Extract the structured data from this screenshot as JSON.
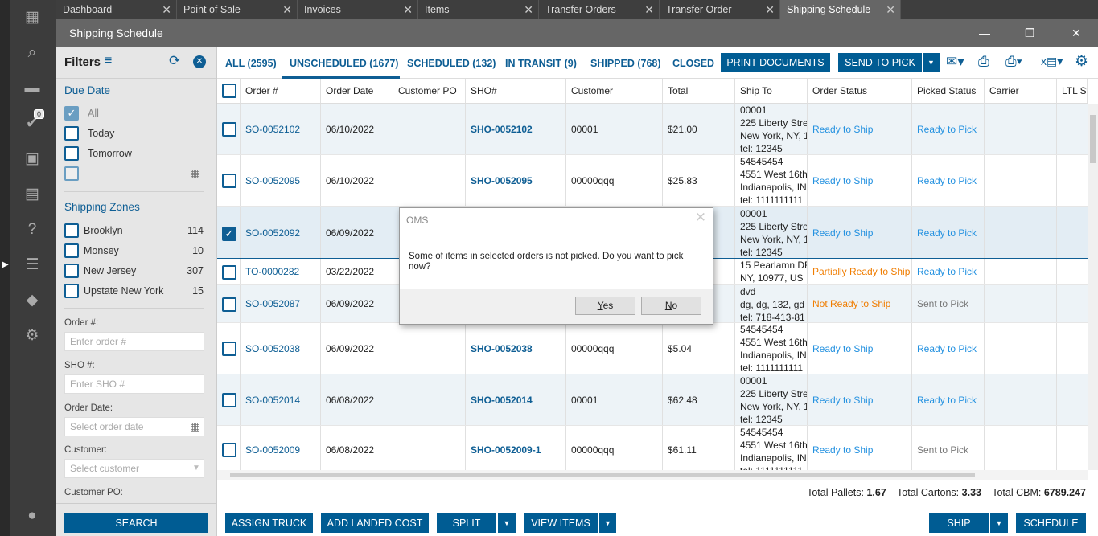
{
  "rail": {
    "icons": [
      "dashboard-icon",
      "search-icon",
      "folder-icon",
      "check-circle-icon",
      "contact-icon",
      "store-icon",
      "clipboard-question-icon",
      "clipboard-list-icon",
      "tag-icon",
      "gear-icon",
      "user-icon"
    ],
    "badge": "0"
  },
  "tabs": [
    {
      "label": "Dashboard"
    },
    {
      "label": "Point of Sale"
    },
    {
      "label": "Invoices"
    },
    {
      "label": "Items"
    },
    {
      "label": "Transfer Orders"
    },
    {
      "label": "Transfer Order"
    },
    {
      "label": "Shipping Schedule",
      "active": true
    }
  ],
  "window": {
    "title": "Shipping Schedule"
  },
  "filters": {
    "title": "Filters",
    "due_date": {
      "title": "Due Date",
      "options": [
        {
          "label": "All",
          "checked": true
        },
        {
          "label": "Today",
          "checked": false
        },
        {
          "label": "Tomorrow",
          "checked": false
        }
      ]
    },
    "zones": {
      "title": "Shipping Zones",
      "items": [
        {
          "label": "Brooklyn",
          "count": "114"
        },
        {
          "label": "Monsey",
          "count": "10"
        },
        {
          "label": "New Jersey",
          "count": "307"
        },
        {
          "label": "Upstate New York",
          "count": "15"
        }
      ]
    },
    "order_label": "Order #:",
    "order_ph": "Enter order #",
    "sho_label": "SHO #:",
    "sho_ph": "Enter SHO #",
    "date_label": "Order Date:",
    "date_ph": "Select order date",
    "customer_label": "Customer:",
    "customer_ph": "Select customer",
    "po_label": "Customer PO:",
    "search": "SEARCH"
  },
  "page_tabs": [
    {
      "label": "ALL (2595)"
    },
    {
      "label": "UNSCHEDULED (1677)",
      "active": true
    },
    {
      "label": "SCHEDULED (132)"
    },
    {
      "label": "IN TRANSIT (9)"
    },
    {
      "label": "SHIPPED (768)"
    },
    {
      "label": "CLOSED"
    }
  ],
  "toolbar": {
    "print": "PRINT DOCUMENTS",
    "send": "SEND TO PICK"
  },
  "columns": [
    "Order #",
    "Order Date",
    "Customer PO",
    "SHO#",
    "Customer",
    "Total",
    "Ship To",
    "Order Status",
    "Picked Status",
    "Carrier",
    "LTL Status"
  ],
  "rows": [
    {
      "order": "SO-0052102",
      "date": "06/10/2022",
      "po": "",
      "sho": "SHO-0052102",
      "customer": "00001",
      "total": "$21.00",
      "ship_to": [
        "00001",
        "225 Liberty Stre",
        "New York, NY, 1",
        "tel: 12345"
      ],
      "status": "Ready to Ship",
      "status_color": "blue",
      "picked": "Ready to Pick",
      "picked_color": "blue",
      "checked": false
    },
    {
      "order": "SO-0052095",
      "date": "06/10/2022",
      "po": "",
      "sho": "SHO-0052095",
      "customer": "00000qqq",
      "total": "$25.83",
      "ship_to": [
        "54545454",
        "4551 West 16th",
        "Indianapolis, IN",
        "tel: 1111111111"
      ],
      "status": "Ready to Ship",
      "status_color": "blue",
      "picked": "Ready to Pick",
      "picked_color": "blue",
      "checked": false
    },
    {
      "order": "SO-0052092",
      "date": "06/09/2022",
      "po": "",
      "sho": "",
      "customer": "",
      "total": "",
      "ship_to": [
        "00001",
        "225 Liberty Stre",
        "New York, NY, 1",
        "tel: 12345"
      ],
      "status": "Ready to Ship",
      "status_color": "blue",
      "picked": "Ready to Pick",
      "picked_color": "blue",
      "checked": true
    },
    {
      "order": "TO-0000282",
      "date": "03/22/2022",
      "po": "",
      "sho": "",
      "customer": "",
      "total": "",
      "ship_to": [
        "15 Pearlamn DF",
        "NY, 10977, US"
      ],
      "status": "Partially Ready to Ship",
      "status_color": "orange",
      "picked": "Ready to Pick",
      "picked_color": "blue",
      "checked": false
    },
    {
      "order": "SO-0052087",
      "date": "06/09/2022",
      "po": "",
      "sho": "",
      "customer": "",
      "total": "",
      "ship_to": [
        "dvd",
        "dg, dg, 132, gd",
        "tel: 718-413-81"
      ],
      "status": "Not Ready to Ship",
      "status_color": "orange",
      "picked": "Sent to Pick",
      "picked_color": "gray",
      "checked": false
    },
    {
      "order": "SO-0052038",
      "date": "06/09/2022",
      "po": "",
      "sho": "SHO-0052038",
      "customer": "00000qqq",
      "total": "$5.04",
      "ship_to": [
        "54545454",
        "4551 West 16th",
        "Indianapolis, IN",
        "tel: 1111111111"
      ],
      "status": "Ready to Ship",
      "status_color": "blue",
      "picked": "Ready to Pick",
      "picked_color": "blue",
      "checked": false
    },
    {
      "order": "SO-0052014",
      "date": "06/08/2022",
      "po": "",
      "sho": "SHO-0052014",
      "customer": "00001",
      "total": "$62.48",
      "ship_to": [
        "00001",
        "225 Liberty Stre",
        "New York, NY, 1",
        "tel: 12345"
      ],
      "status": "Ready to Ship",
      "status_color": "blue",
      "picked": "Ready to Pick",
      "picked_color": "blue",
      "checked": false
    },
    {
      "order": "SO-0052009",
      "date": "06/08/2022",
      "po": "",
      "sho": "SHO-0052009-1",
      "customer": "00000qqq",
      "total": "$61.11",
      "ship_to": [
        "54545454",
        "4551 West 16th",
        "Indianapolis, IN",
        "tel: 1111111111"
      ],
      "status": "Ready to Ship",
      "status_color": "blue",
      "picked": "Sent to Pick",
      "picked_color": "gray",
      "checked": false
    }
  ],
  "totals": {
    "pallets_label": "Total Pallets:",
    "pallets": "1.67",
    "cartons_label": "Total Cartons:",
    "cartons": "3.33",
    "cbm_label": "Total CBM:",
    "cbm": "6789.247"
  },
  "bottom": {
    "assign": "ASSIGN TRUCK",
    "landed": "ADD LANDED COST",
    "split": "SPLIT",
    "view": "VIEW ITEMS",
    "ship": "SHIP",
    "schedule": "SCHEDULE"
  },
  "dialog": {
    "title": "OMS",
    "message": "Some of items in selected orders is not picked. Do you want to pick now?",
    "yes_key": "Y",
    "yes_rest": "es",
    "no_key": "N",
    "no_rest": "o"
  },
  "colors": {
    "primary": "#005c93",
    "link": "#2391e0",
    "warning": "#f07d00"
  }
}
